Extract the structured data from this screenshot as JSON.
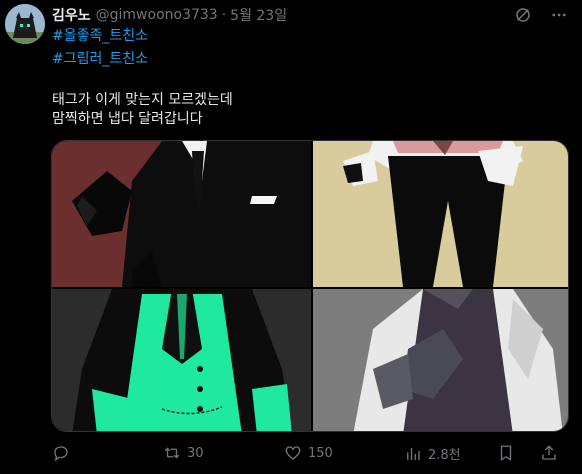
{
  "tweet": {
    "author_name": "김우노",
    "handle": "@gimwoono3733",
    "separator": "·",
    "date": "5월 23일",
    "hashtags": [
      "#올좋족_트친소",
      "#그림러_트친소"
    ],
    "text_lines": [
      "태그가 이게 맞는지 모르겠는데",
      "맘찍하면 냅다 달려갑니다"
    ]
  },
  "media": {
    "tiles": [
      {
        "name": "black-suit-illustration",
        "bg": "#6b2f2f"
      },
      {
        "name": "white-shirt-illustration",
        "bg": "#d8cc9c"
      },
      {
        "name": "green-vest-illustration",
        "bg": "#2c2c2c"
      },
      {
        "name": "white-coat-illustration",
        "bg": "#7d7d7d"
      }
    ]
  },
  "actions": {
    "reply": {
      "icon": "reply-icon",
      "count": ""
    },
    "retweet": {
      "icon": "retweet-icon",
      "count": "30"
    },
    "like": {
      "icon": "heart-icon",
      "count": "150"
    },
    "views": {
      "icon": "views-icon",
      "count": "2.8천"
    },
    "bookmark": {
      "icon": "bookmark-icon",
      "count": ""
    },
    "share": {
      "icon": "share-icon",
      "count": ""
    }
  },
  "colors": {
    "background": "#000000",
    "text": "#e7e9ea",
    "muted": "#71767b",
    "link": "#1d9bf0"
  }
}
